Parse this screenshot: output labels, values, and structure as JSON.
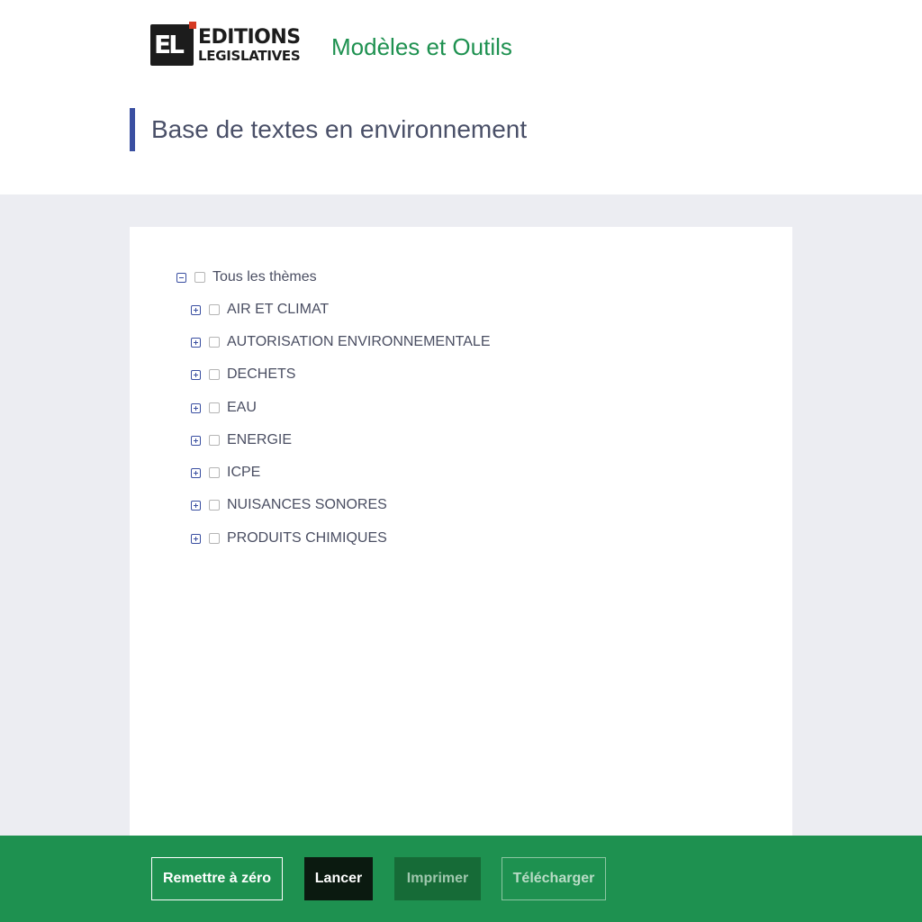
{
  "header": {
    "logo": {
      "icon": "el-logo-mark",
      "line1": "EDITIONS",
      "line2": "LEGISLATIVES"
    },
    "app_title": "Modèles et Outils",
    "page_title": "Base de textes en environnement"
  },
  "tree": {
    "root": {
      "label": "Tous les thèmes",
      "expanded": true,
      "checked": false
    },
    "items": [
      {
        "label": "AIR ET CLIMAT",
        "expanded": false,
        "checked": false
      },
      {
        "label": "AUTORISATION ENVIRONNEMENTALE",
        "expanded": false,
        "checked": false
      },
      {
        "label": "DECHETS",
        "expanded": false,
        "checked": false
      },
      {
        "label": "EAU",
        "expanded": false,
        "checked": false
      },
      {
        "label": "ENERGIE",
        "expanded": false,
        "checked": false
      },
      {
        "label": "ICPE",
        "expanded": false,
        "checked": false
      },
      {
        "label": "NUISANCES SONORES",
        "expanded": false,
        "checked": false
      },
      {
        "label": "PRODUITS CHIMIQUES",
        "expanded": false,
        "checked": false
      }
    ]
  },
  "footer": {
    "reset_label": "Remettre à zéro",
    "launch_label": "Lancer",
    "print_label": "Imprimer",
    "download_label": "Télécharger"
  },
  "colors": {
    "brand_green": "#1e9150",
    "accent_blue": "#3a4fa1",
    "logo_red": "#d63a22",
    "content_background": "#ecedf2"
  }
}
